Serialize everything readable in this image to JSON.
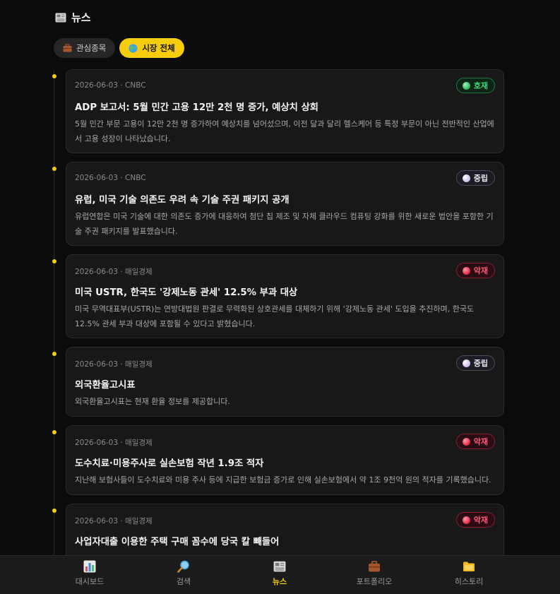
{
  "header": {
    "icon": "newspaper-icon",
    "title": "뉴스"
  },
  "tabs": [
    {
      "label": "관심종목",
      "icon": "briefcase-icon",
      "active": false
    },
    {
      "label": "시장 전체",
      "icon": "globe-icon",
      "active": true
    }
  ],
  "colors": {
    "accent": "#f5cd0c",
    "good": "#3ddc7a",
    "bad": "#ff5a73",
    "neutral": "#e6e6ee"
  },
  "news": [
    {
      "meta": "2026-06-03 · CNBC",
      "badge": "호재",
      "sentiment": "good",
      "headline": "ADP 보고서: 5월 민간 고용 12만 2천 명 증가, 예상치 상회",
      "summary": "5월 민간 부문 고용이 12만 2천 명 증가하여 예상치를 넘어섰으며, 이전 달과 달리 헬스케어 등 특정 부문이 아닌 전반적인 산업에서 고용 성장이 나타났습니다."
    },
    {
      "meta": "2026-06-03 · CNBC",
      "badge": "중립",
      "sentiment": "neutral",
      "headline": "유럽, 미국 기술 의존도 우려 속 기술 주권 패키지 공개",
      "summary": "유럽연합은 미국 기술에 대한 의존도 증가에 대응하여 첨단 칩 제조 및 자체 클라우드 컴퓨팅 강화를 위한 새로운 법안을 포함한 기술 주권 패키지를 발표했습니다."
    },
    {
      "meta": "2026-06-03 · 매일경제",
      "badge": "악재",
      "sentiment": "bad",
      "headline": "미국 USTR, 한국도 '강제노동 관세' 12.5% 부과 대상",
      "summary": "미국 무역대표부(USTR)는 연방대법원 판결로 무력화된 상호관세를 대체하기 위해 '강제노동 관세' 도입을 추진하며, 한국도 12.5% 관세 부과 대상에 포함될 수 있다고 밝혔습니다."
    },
    {
      "meta": "2026-06-03 · 매일경제",
      "badge": "중립",
      "sentiment": "neutral",
      "headline": "외국환율고시표",
      "summary": "외국환율고시표는 현재 환율 정보를 제공합니다."
    },
    {
      "meta": "2026-06-03 · 매일경제",
      "badge": "악재",
      "sentiment": "bad",
      "headline": "도수치료·미용주사로 실손보험 작년 1.9조 적자",
      "summary": "지난해 보험사들이 도수치료와 미용 주사 등에 지급한 보험금 증가로 인해 실손보험에서 약 1조 9천억 원의 적자를 기록했습니다."
    },
    {
      "meta": "2026-06-03 · 매일경제",
      "badge": "악재",
      "sentiment": "bad",
      "headline": "사업자대출 이용한 주택 구매 꼼수에 당국 칼 빼들어",
      "summary": ""
    }
  ],
  "bottom_nav": [
    {
      "label": "대시보드",
      "icon": "dashboard-chart-icon",
      "active": false
    },
    {
      "label": "검색",
      "icon": "search-icon",
      "active": false
    },
    {
      "label": "뉴스",
      "icon": "newspaper-icon",
      "active": true
    },
    {
      "label": "포트폴리오",
      "icon": "briefcase-icon",
      "active": false
    },
    {
      "label": "히스토리",
      "icon": "folder-icon",
      "active": false
    }
  ]
}
